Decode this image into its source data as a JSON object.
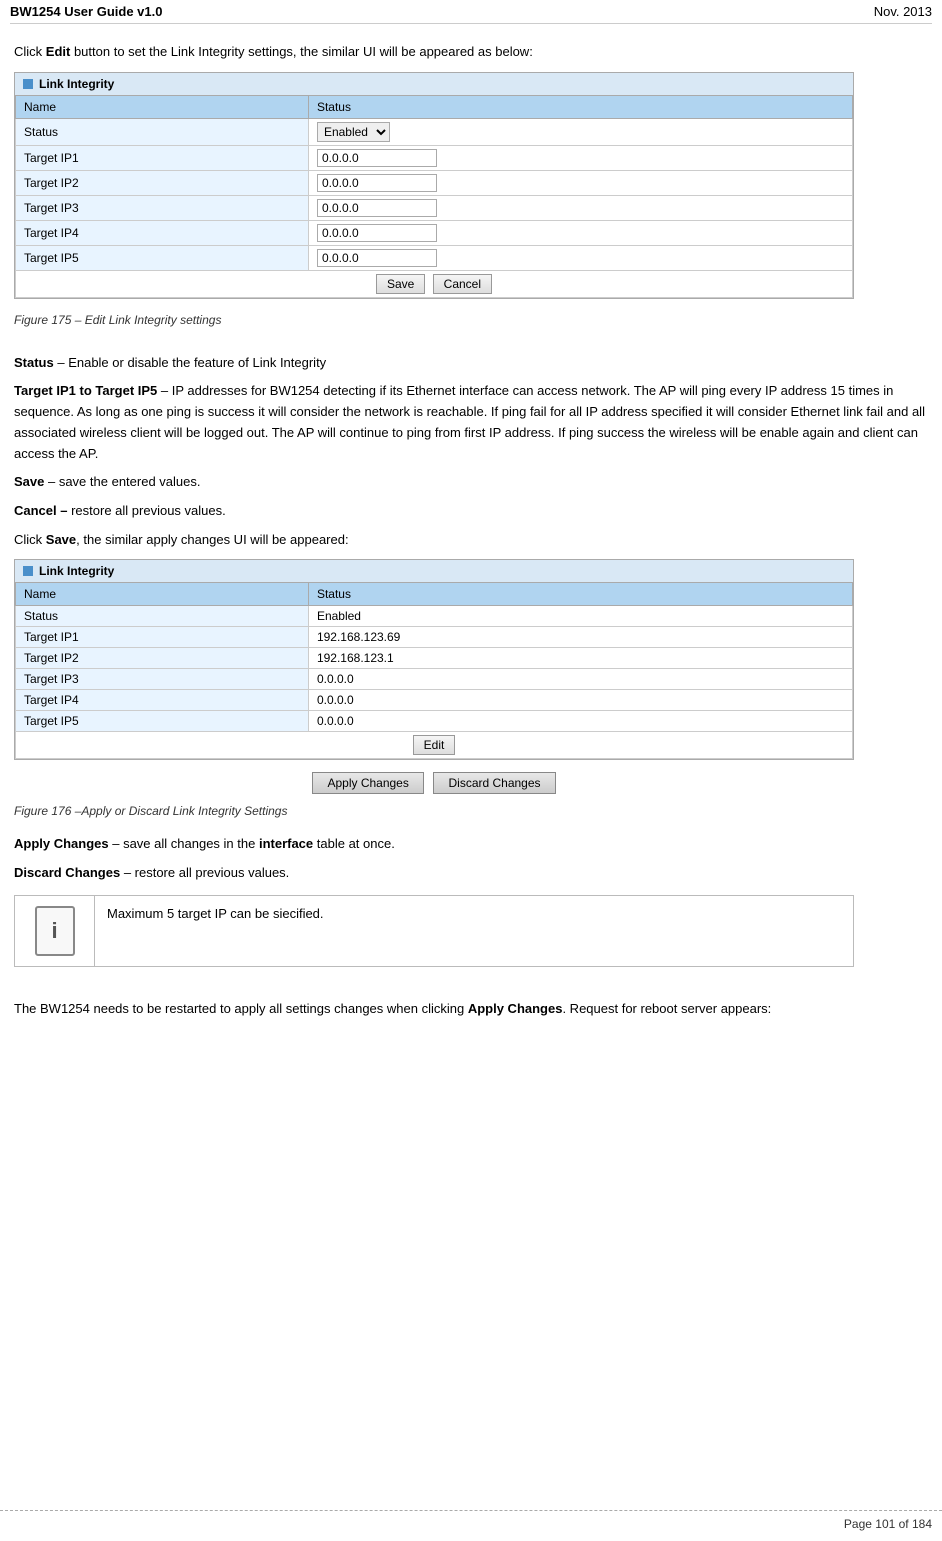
{
  "header": {
    "title": "BW1254 User Guide v1.0",
    "date": "Nov.  2013"
  },
  "intro": {
    "text1_pre": "Click ",
    "text1_bold": "Edit",
    "text1_post": " button to set the Link Integrity settings, the similar UI will be appeared as below:"
  },
  "table1": {
    "box_header": "Link Integrity",
    "col_name": "Name",
    "col_status": "Status",
    "rows": [
      {
        "name": "Status",
        "status_type": "select",
        "status_val": "Enabled"
      },
      {
        "name": "Target IP1",
        "status_type": "input",
        "status_val": "0.0.0.0"
      },
      {
        "name": "Target IP2",
        "status_type": "input",
        "status_val": "0.0.0.0"
      },
      {
        "name": "Target IP3",
        "status_type": "input",
        "status_val": "0.0.0.0"
      },
      {
        "name": "Target IP4",
        "status_type": "input",
        "status_val": "0.0.0.0"
      },
      {
        "name": "Target IP5",
        "status_type": "input",
        "status_val": "0.0.0.0"
      }
    ],
    "save_btn": "Save",
    "cancel_btn": "Cancel"
  },
  "figure1_caption": "Figure 175 – Edit  Link Integrity settings",
  "section1": {
    "status_label": "Status",
    "status_text": " – Enable or disable the feature of Link Integrity"
  },
  "section2": {
    "label": "Target IP1 to Target IP5",
    "text": " – IP addresses for BW1254 detecting if its Ethernet interface can access network. The AP will ping every IP address 15 times in sequence. As long as one ping is success it will consider the network is reachable. If ping fail for all IP address specified  it will consider Ethernet link fail and all associated wireless client will be logged out. The AP will continue to ping from first IP address. If ping success the wireless will be enable again and client can access the AP."
  },
  "section3": {
    "label": "Save",
    "text": " – save the entered values."
  },
  "section4": {
    "label": "Cancel –",
    "text": " restore all previous values."
  },
  "section5_pre": "Click ",
  "section5_bold": "Save",
  "section5_post": ", the similar apply changes UI will be appeared:",
  "table2": {
    "box_header": "Link Integrity",
    "col_name": "Name",
    "col_status": "Status",
    "rows": [
      {
        "name": "Status",
        "status_val": "Enabled"
      },
      {
        "name": "Target IP1",
        "status_val": "192.168.123.69"
      },
      {
        "name": "Target IP2",
        "status_val": "192.168.123.1"
      },
      {
        "name": "Target IP3",
        "status_val": "0.0.0.0"
      },
      {
        "name": "Target IP4",
        "status_val": "0.0.0.0"
      },
      {
        "name": "Target IP5",
        "status_val": "0.0.0.0"
      }
    ],
    "edit_btn": "Edit"
  },
  "apply_changes_btn": "Apply Changes",
  "discard_changes_btn": "Discard Changes",
  "figure2_caption": "Figure 176 –Apply or Discard Link Integrity Settings",
  "section_apply": {
    "label": "Apply Changes",
    "pre": " – save all changes in the ",
    "bold": "interface",
    "post": " table at once."
  },
  "section_discard": {
    "label": "Discard Changes",
    "text": " – restore all previous values."
  },
  "note_text": "Maximum 5 target IP can be siecified.",
  "final_text_pre": "The BW1254 needs to be restarted to apply all settings changes when clicking ",
  "final_text_bold": "Apply Changes",
  "final_text_post": ". Request for reboot server appears:",
  "page_number": "Page 101 of 184"
}
